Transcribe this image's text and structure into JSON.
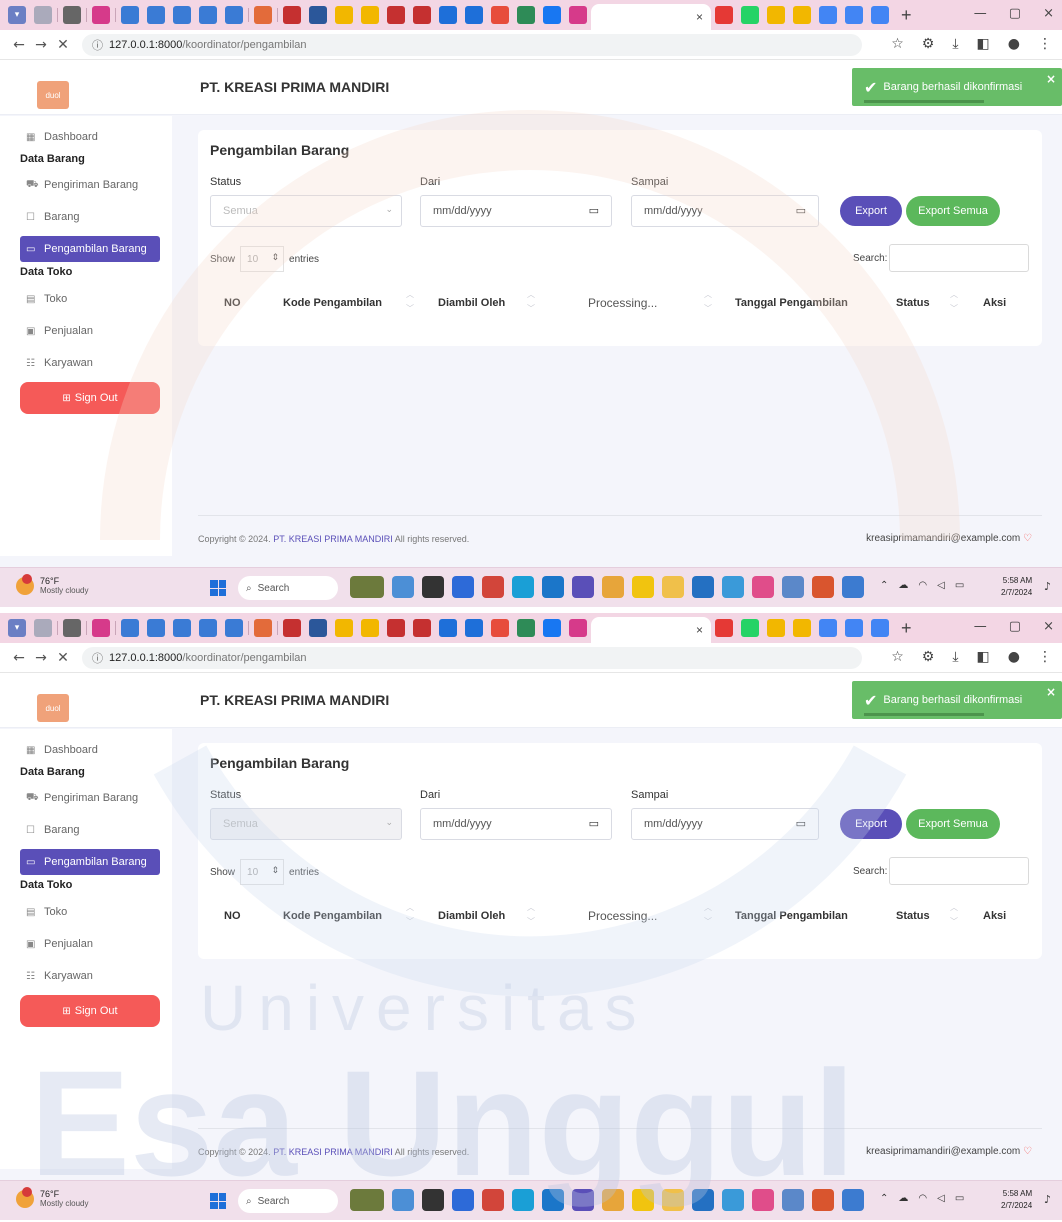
{
  "browser": {
    "tab_close": "×",
    "new_tab": "+",
    "url_host": "127.0.0.1:8000",
    "url_path": "/koordinator/pengambilan",
    "win_minimize": "—",
    "win_restore": "▢",
    "win_close": "×"
  },
  "app": {
    "logo_text": "duol",
    "company_name": "PT. KREASI PRIMA MANDIRI"
  },
  "toast": {
    "message": "Barang berhasil dikonfirmasi",
    "close": "×"
  },
  "sidebar": {
    "dashboard": "Dashboard",
    "section_data_barang": "Data Barang",
    "pengiriman": "Pengiriman Barang",
    "barang": "Barang",
    "pengambilan": "Pengambilan Barang",
    "section_data_toko": "Data Toko",
    "toko": "Toko",
    "penjualan": "Penjualan",
    "karyawan": "Karyawan",
    "sign_out": "Sign Out"
  },
  "main": {
    "title": "Pengambilan Barang",
    "status_label": "Status",
    "status_value": "Semua",
    "dari_label": "Dari",
    "dari_value": "mm/dd/yyyy",
    "sampai_label": "Sampai",
    "sampai_value": "mm/dd/yyyy",
    "export": "Export",
    "export_all": "Export Semua",
    "show": "Show",
    "entries_value": "10",
    "entries": "entries",
    "search_label": "Search:",
    "processing": "Processing...",
    "columns": {
      "no": "NO",
      "kode": "Kode Pengambilan",
      "diambil": "Diambil Oleh",
      "tanggal": "Tanggal Pengambilan",
      "status": "Status",
      "aksi": "Aksi"
    }
  },
  "footer": {
    "copy_prefix": "Copyright © 2024.",
    "company": "PT. KREASI PRIMA MANDIRI",
    "copy_suffix": "All rights reserved.",
    "email": "kreasiprimamandiri@example.com",
    "heart": "♡"
  },
  "taskbar": {
    "temp": "76°F",
    "weather": "Mostly cloudy",
    "search": "Search",
    "time": "5:58 AM",
    "date": "2/7/2024"
  },
  "watermark": {
    "line1": "Universitas",
    "line2": "Esa Unggul"
  },
  "colors": {
    "primary": "#5a4fb8",
    "success": "#5cb85c",
    "danger": "#f55a58",
    "logo": "#f0a27a"
  }
}
